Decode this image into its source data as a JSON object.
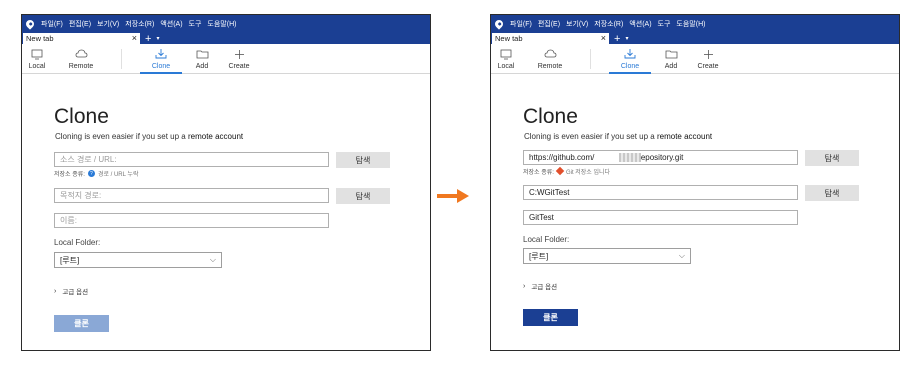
{
  "colors": {
    "titlebar": "#1b3f93",
    "accent": "#2a7ad6",
    "arrow": "#f07820",
    "button_primary": "#1b3f93",
    "button_disabled": "#8aa8d6"
  },
  "menu": [
    "파일(F)",
    "편집(E)",
    "보기(V)",
    "저장소(R)",
    "액션(A)",
    "도구",
    "도움말(H)"
  ],
  "tab": {
    "label": "New tab",
    "close": "×",
    "new": "+",
    "dropdown": "▾"
  },
  "toolbar": [
    {
      "label": "Local",
      "icon": "monitor-icon"
    },
    {
      "label": "Remote",
      "icon": "cloud-icon"
    },
    {
      "label": "Clone",
      "icon": "download-icon",
      "active": true
    },
    {
      "label": "Add",
      "icon": "folder-icon"
    },
    {
      "label": "Create",
      "icon": "plus-icon"
    }
  ],
  "before": {
    "title": "Clone",
    "subtitle_prefix": "Cloning is even easier if you set up a ",
    "subtitle_link": "remote account",
    "source_placeholder": "소스 경로 / URL:",
    "browse_label": "탐색",
    "repo_type_label": "저장소 종류:",
    "repo_type_icon": "info-icon",
    "repo_type_value": "경로 / URL 누락",
    "dest_placeholder": "목적지 경로:",
    "name_placeholder": "이름:",
    "local_folder_label": "Local Folder:",
    "local_folder_value": "[루트]",
    "advanced_label": "고급 옵션",
    "clone_button": "클론"
  },
  "after": {
    "title": "Clone",
    "subtitle_prefix": "Cloning is even easier if you set up a ",
    "subtitle_link": "remote account",
    "source_value_start": "https://github.com/",
    "source_value_end": "MyRepository.git",
    "browse_label": "탐색",
    "repo_type_label": "저장소 종류:",
    "repo_type_icon": "git-icon",
    "repo_type_value": "Git 저장소 입니다",
    "dest_value": "C:WGitTest",
    "name_value": "GitTest",
    "local_folder_label": "Local Folder:",
    "local_folder_value": "[루트]",
    "advanced_label": "고급 옵션",
    "clone_button": "클론"
  }
}
